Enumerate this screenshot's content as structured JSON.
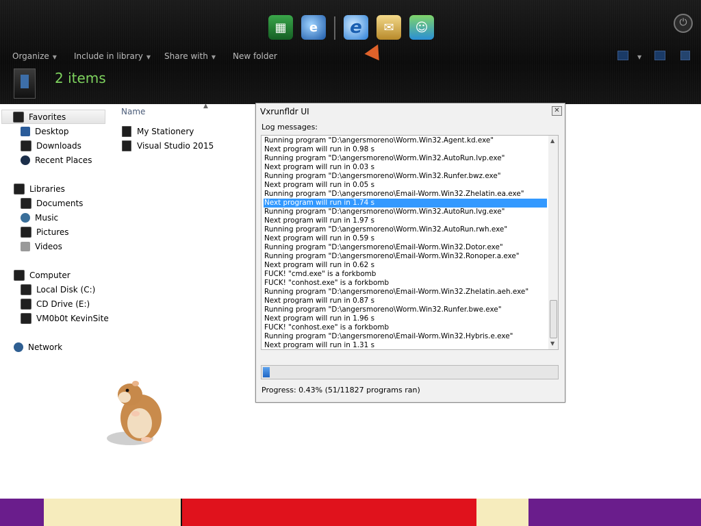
{
  "explorer": {
    "toolbar": {
      "organize": "Organize",
      "include_in_library": "Include in library",
      "share_with": "Share with",
      "new_folder": "New folder"
    },
    "items_count": "2 items",
    "column_header": "Name",
    "files": [
      "My Stationery",
      "Visual Studio 2015"
    ],
    "nav": {
      "favorites": {
        "label": "Favorites",
        "items": [
          "Desktop",
          "Downloads",
          "Recent Places"
        ]
      },
      "libraries": {
        "label": "Libraries",
        "items": [
          "Documents",
          "Music",
          "Pictures",
          "Videos"
        ]
      },
      "computer": {
        "label": "Computer",
        "items": [
          "Local Disk (C:)",
          "CD Drive (E:)",
          "VM0b0t KevinSite"
        ]
      },
      "network": {
        "label": "Network"
      }
    }
  },
  "dialog": {
    "title": "Vxrunfldr UI",
    "log_label": "Log messages:",
    "log_lines": [
      "Running program \"D:\\angersmoreno\\Worm.Win32.Agent.kd.exe\"",
      "Next program will run in 0.98 s",
      "Running program \"D:\\angersmoreno\\Worm.Win32.AutoRun.lvp.exe\"",
      "Next program will run in 0.03 s",
      "Running program \"D:\\angersmoreno\\Worm.Win32.Runfer.bwz.exe\"",
      "Next program will run in 0.05 s",
      "Running program \"D:\\angersmoreno\\Email-Worm.Win32.Zhelatin.ea.exe\"",
      "Next program will run in 1.74 s",
      "Running program \"D:\\angersmoreno\\Worm.Win32.AutoRun.lvg.exe\"",
      "Next program will run in 1.97 s",
      "Running program \"D:\\angersmoreno\\Worm.Win32.AutoRun.rwh.exe\"",
      "Next program will run in 0.59 s",
      "Running program \"D:\\angersmoreno\\Email-Worm.Win32.Dotor.exe\"",
      "Running program \"D:\\angersmoreno\\Email-Worm.Win32.Ronoper.a.exe\"",
      "Next program will run in 0.62 s",
      "FUCK! \"cmd.exe\" is a forkbomb",
      "FUCK! \"conhost.exe\" is a forkbomb",
      "Running program \"D:\\angersmoreno\\Email-Worm.Win32.Zhelatin.aeh.exe\"",
      "Next program will run in 0.87 s",
      "Running program \"D:\\angersmoreno\\Worm.Win32.Runfer.bwe.exe\"",
      "Next program will run in 1.96 s",
      "FUCK! \"conhost.exe\" is a forkbomb",
      "Running program \"D:\\angersmoreno\\Email-Worm.Win32.Hybris.e.exe\"",
      "Next program will run in 1.31 s"
    ],
    "selected_line_index": 7,
    "progress_percent": 0.43,
    "progress_text": "Progress: 0.43% (51/11827 programs ran)"
  },
  "colors": {
    "chrome_bg": "#111111",
    "items_count_green": "#7ed35e",
    "selection_blue": "#3399ff",
    "progress_blue": "#1f66c4"
  },
  "icons": [
    "app-icon",
    "ie-icon",
    "mail-icon",
    "messenger-icon",
    "power-icon"
  ]
}
